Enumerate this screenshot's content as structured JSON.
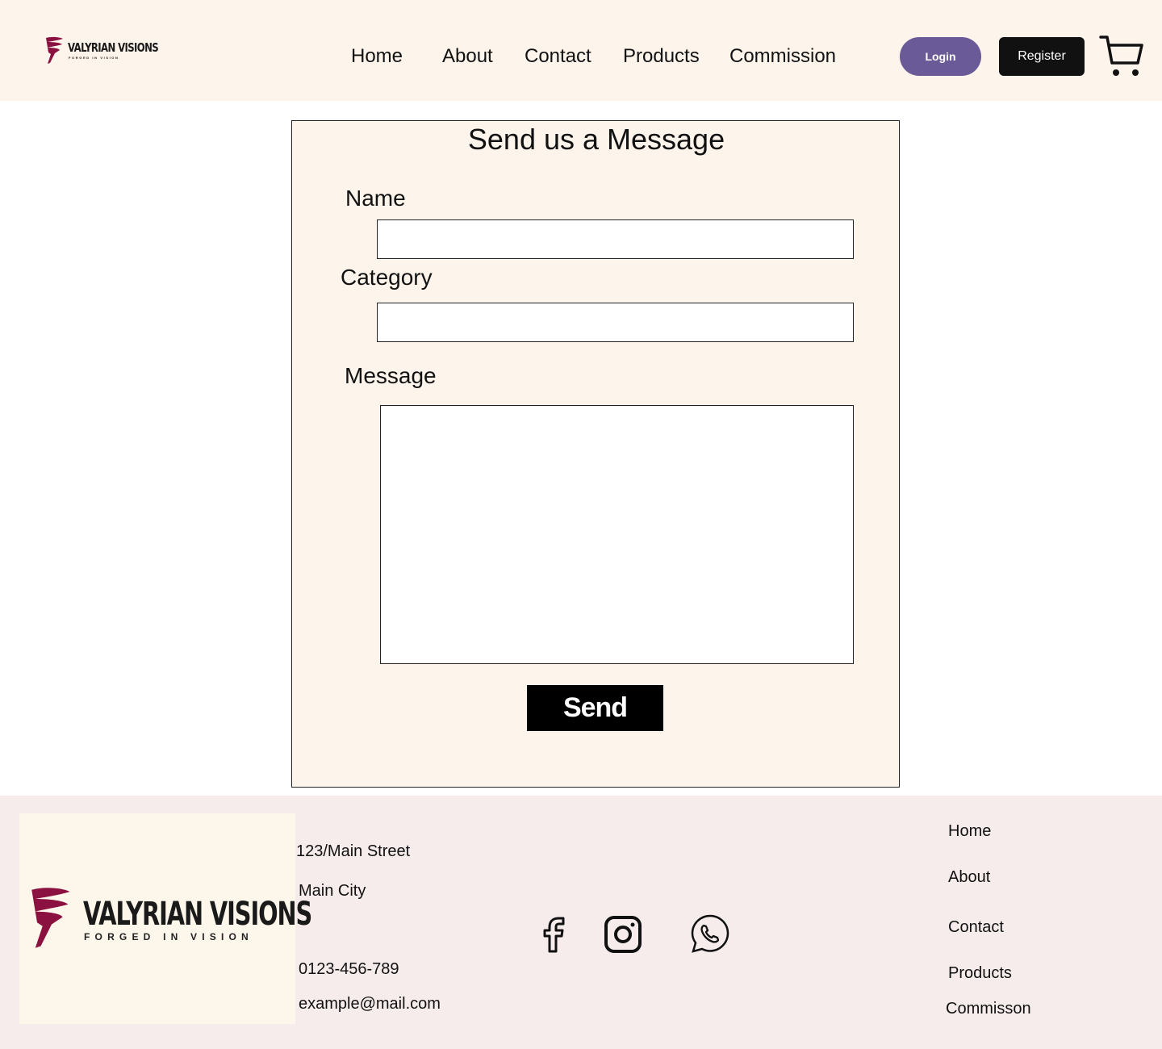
{
  "brand": {
    "name": "VALYRIAN VISIONS",
    "tagline": "FORGED IN VISION",
    "accent_color": "#8b1240"
  },
  "header": {
    "nav": [
      "Home",
      "About",
      "Contact",
      "Products",
      "Commission"
    ],
    "login_label": "Login",
    "register_label": "Register",
    "login_color": "#6b5a98",
    "cart_icon": "cart-icon"
  },
  "form": {
    "title": "Send us a Message",
    "name_label": "Name",
    "name_value": "",
    "category_label": "Category",
    "category_value": "",
    "message_label": "Message",
    "message_value": "",
    "send_label": "Send"
  },
  "footer": {
    "address_line1": "123/Main Street",
    "address_line2": "Main City",
    "phone": "0123-456-789",
    "email": "example@mail.com",
    "social_icons": [
      "facebook-icon",
      "instagram-icon",
      "whatsapp-icon"
    ],
    "nav": [
      "Home",
      "About",
      "Contact",
      "Products",
      "Commisson"
    ]
  }
}
